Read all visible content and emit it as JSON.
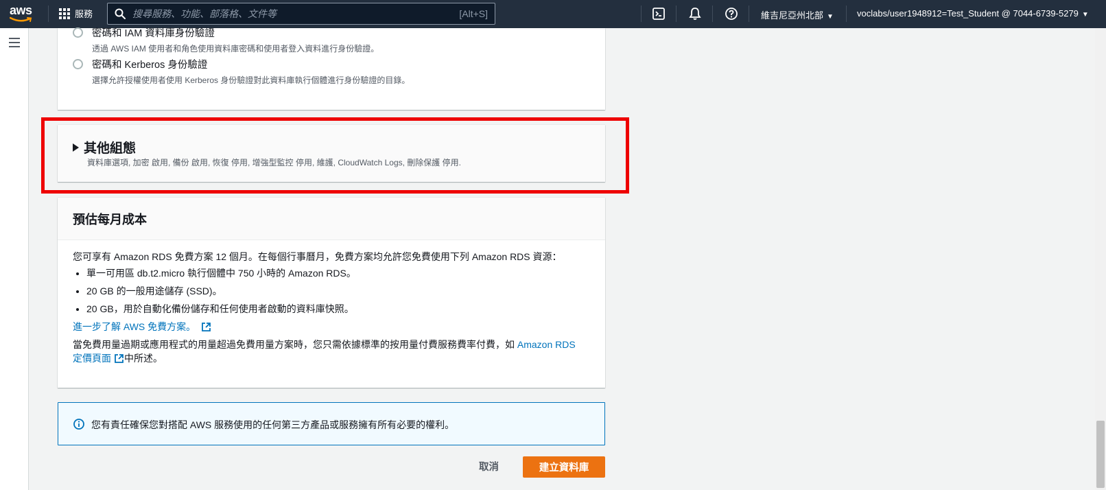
{
  "nav": {
    "logo_text": "aws",
    "services_label": "服務",
    "search_placeholder": "搜尋服務、功能、部落格、文件等",
    "search_shortcut": "[Alt+S]",
    "region_label": "維吉尼亞州北部",
    "account_label": "voclabs/user1948912=Test_Student @ 7044-6739-5279"
  },
  "auth": {
    "options": [
      {
        "title": "密碼和 IAM 資料庫身份驗證",
        "desc": "透過 AWS IAM 使用者和角色使用資料庫密碼和使用者登入資料進行身份驗證。"
      },
      {
        "title": "密碼和 Kerberos 身份驗證",
        "desc": "選擇允許授權使用者使用 Kerberos 身份驗證對此資料庫執行個體進行身份驗證的目錄。"
      }
    ]
  },
  "additional_config": {
    "title": "其他組態",
    "desc": "資料庫選項, 加密 啟用, 備份 啟用, 恢復 停用, 增強型監控 停用, 維護, CloudWatch Logs, 刪除保護 停用."
  },
  "cost": {
    "title": "預估每月成本",
    "intro": "您可享有 Amazon RDS 免費方案 12 個月。在每個行事曆月，免費方案均允許您免費使用下列 Amazon RDS 資源：",
    "bullets": [
      "單一可用區 db.t2.micro 執行個體中 750 小時的 Amazon RDS。",
      "20 GB 的一般用途儲存 (SSD)。",
      "20 GB，用於自動化備份儲存和任何使用者啟動的資料庫快照。"
    ],
    "learn_more_link": "進一步了解 AWS 免費方案。",
    "outro_prefix": "當免費用量過期或應用程式的用量超過免費用量方案時，您只需依據標準的按用量付費服務費率付費，如 ",
    "pricing_link": "Amazon RDS 定價頁面",
    "outro_suffix": "中所述。"
  },
  "info_alert": {
    "text": "您有責任確保您對搭配 AWS 服務使用的任何第三方產品或服務擁有所有必要的權利。"
  },
  "actions": {
    "cancel_label": "取消",
    "create_label": "建立資料庫"
  },
  "colors": {
    "nav_bg": "#232f3e",
    "primary_button": "#ec7211",
    "link": "#0073bb",
    "highlight_box": "#ee0000",
    "info_bg": "#f1faff"
  }
}
